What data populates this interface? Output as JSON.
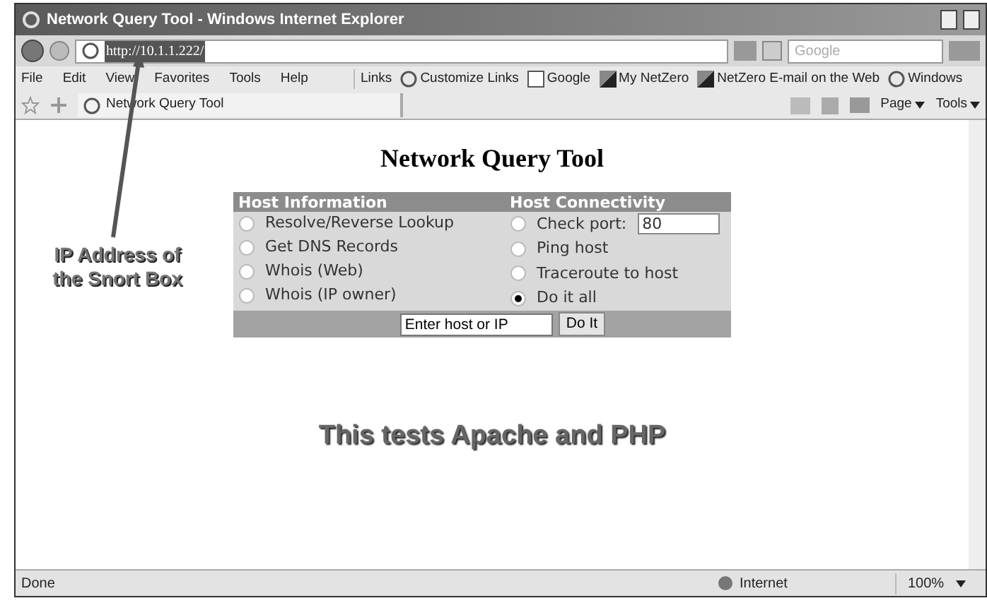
{
  "window": {
    "title": "Network Query Tool - Windows Internet Explorer"
  },
  "address_bar": {
    "url": "http://10.1.1.222/",
    "search_placeholder": "Google"
  },
  "menu": [
    "File",
    "Edit",
    "View",
    "Favorites",
    "Tools",
    "Help"
  ],
  "links_bar": {
    "label": "Links",
    "items": [
      {
        "label": "Customize Links",
        "kind": "ie"
      },
      {
        "label": "Google",
        "kind": "g"
      },
      {
        "label": "My NetZero",
        "kind": "nz"
      },
      {
        "label": "NetZero E-mail on the Web",
        "kind": "nz"
      },
      {
        "label": "Windows",
        "kind": "ie"
      }
    ]
  },
  "tab": {
    "title": "Network Query Tool"
  },
  "command_bar": {
    "page": "Page",
    "tools": "Tools"
  },
  "page": {
    "heading": "Network Query Tool",
    "form": {
      "headers": [
        "Host Information",
        "Host Connectivity"
      ],
      "left_options": [
        {
          "label": "Resolve/Reverse Lookup",
          "selected": false
        },
        {
          "label": "Get DNS Records",
          "selected": false
        },
        {
          "label": "Whois (Web)",
          "selected": false
        },
        {
          "label": "Whois (IP owner)",
          "selected": false
        }
      ],
      "right_options": [
        {
          "label": "Check port:",
          "selected": false
        },
        {
          "label": "Ping host",
          "selected": false
        },
        {
          "label": "Traceroute to host",
          "selected": false
        },
        {
          "label": "Do it all",
          "selected": true
        }
      ],
      "port": "80",
      "host": "Enter host or IP",
      "button": "Do It"
    },
    "caption": "This tests Apache and PHP"
  },
  "annotation": "IP Address of the Snort Box",
  "status_bar": {
    "text": "Done",
    "zone": "Internet",
    "zoom": "100%"
  }
}
